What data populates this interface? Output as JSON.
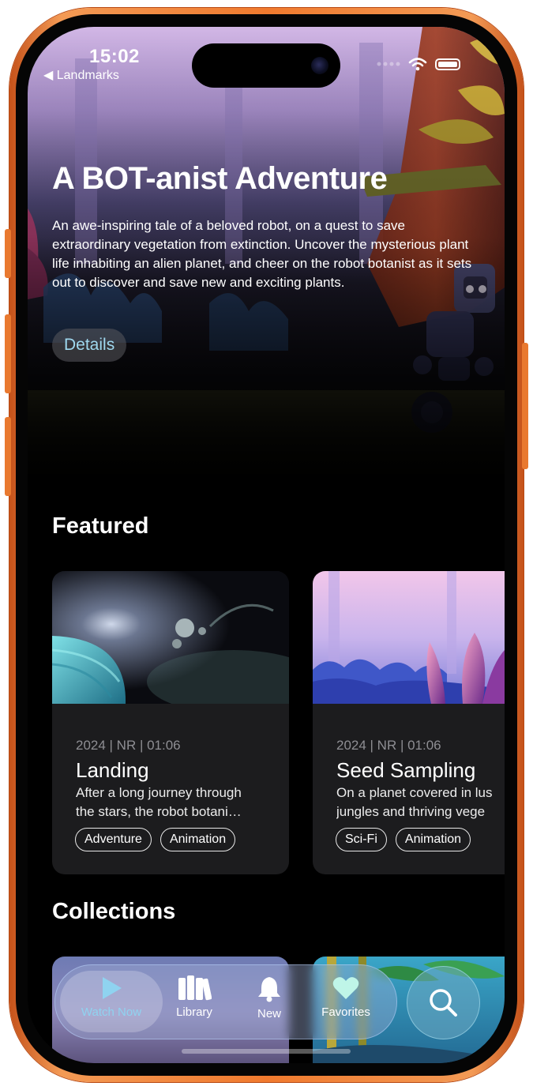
{
  "status_bar": {
    "time": "15:02",
    "back_label": "◀ Landmarks"
  },
  "hero": {
    "title": "A BOT-anist Adventure",
    "description": "An awe-inspiring tale of a beloved robot, on a quest to save extraordinary vegetation from extinction. Uncover the mysterious plant life inhabiting an alien planet, and cheer on the robot botanist as it sets out to discover and save new and exciting plants.",
    "details_label": "Details"
  },
  "featured": {
    "title": "Featured",
    "cards": [
      {
        "meta": "2024 | NR | 01:06",
        "title": "Landing",
        "desc_line1": "After a long journey through",
        "desc_line2": "the stars, the robot botani…",
        "tags": [
          "Adventure",
          "Animation"
        ]
      },
      {
        "meta": "2024 | NR | 01:06",
        "title": "Seed Sampling",
        "desc_line1": "On a planet covered in lus",
        "desc_line2": "jungles and thriving vege",
        "tags": [
          "Sci-Fi",
          "Animation"
        ]
      }
    ]
  },
  "collections": {
    "title": "Collections"
  },
  "tab_bar": {
    "tabs": [
      {
        "label": "Watch Now",
        "icon": "play-icon",
        "active": true
      },
      {
        "label": "Library",
        "icon": "books-icon",
        "active": false
      },
      {
        "label": "New",
        "icon": "bell-icon",
        "active": false
      },
      {
        "label": "Favorites",
        "icon": "heart-icon",
        "active": false
      }
    ],
    "search_icon": "search-icon"
  },
  "colors": {
    "frame": "#f07a2e",
    "accent": "#9fd8ef",
    "active_tab": "#8fd3f0",
    "card_bg": "#1c1c1e"
  }
}
